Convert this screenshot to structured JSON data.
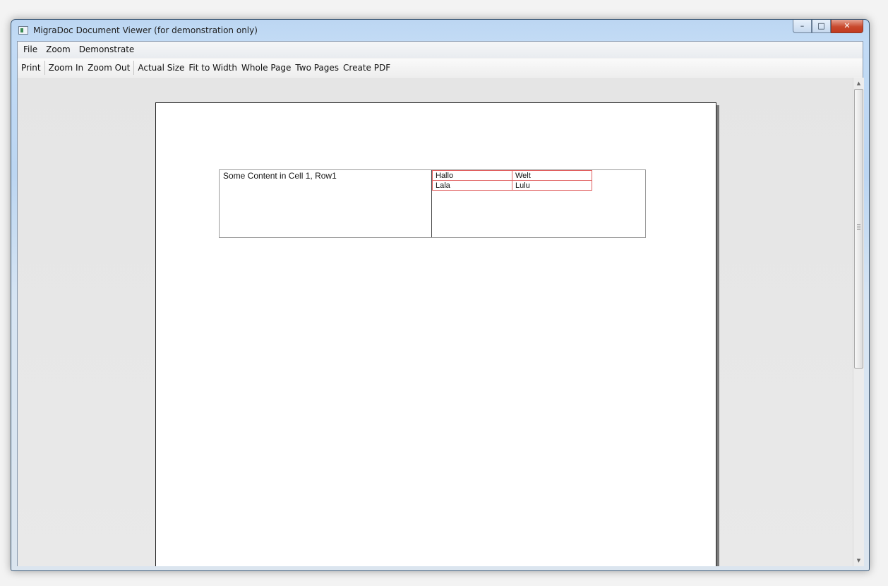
{
  "window": {
    "title": "MigraDoc Document Viewer (for demonstration only)",
    "caption_buttons": {
      "minimize": "–",
      "maximize": "□",
      "close": "✕"
    }
  },
  "menubar": {
    "items": [
      {
        "label": "File"
      },
      {
        "label": "Zoom"
      },
      {
        "label": "Demonstrate"
      }
    ]
  },
  "toolbar": {
    "print": "Print",
    "zoom_in": "Zoom In",
    "zoom_out": "Zoom Out",
    "actual_size": "Actual Size",
    "fit_to_width": "Fit to Width",
    "whole_page": "Whole Page",
    "two_pages": "Two Pages",
    "create_pdf": "Create PDF"
  },
  "document": {
    "outer_table": {
      "cell1_text": "Some Content in Cell 1, Row1",
      "inner_table": {
        "rows": [
          [
            "Hallo",
            "Welt"
          ],
          [
            "Lala",
            "Lulu"
          ]
        ]
      }
    }
  },
  "scrollbar": {
    "up_arrow": "▲",
    "down_arrow": "▼"
  },
  "colors": {
    "inner_table_border": "#e06060",
    "close_button": "#c8492d",
    "title_bar": "#bcd6f2"
  }
}
